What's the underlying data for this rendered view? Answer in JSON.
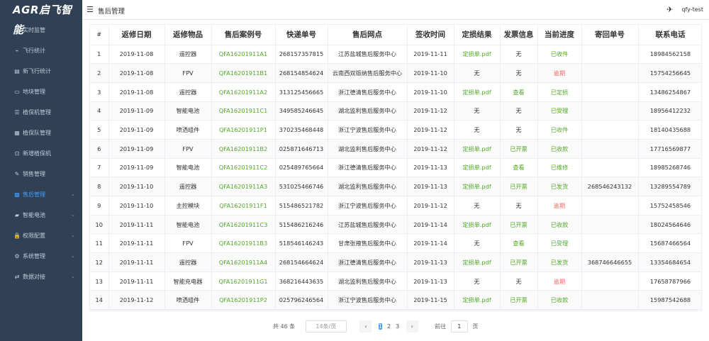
{
  "app": {
    "logo": "AGR启飞智能"
  },
  "sidebar": {
    "items": [
      {
        "icon": "◎",
        "label": "实时监管",
        "chevron": false,
        "active": false
      },
      {
        "icon": "⌁",
        "label": "飞行统计",
        "chevron": false,
        "active": false
      },
      {
        "icon": "▤",
        "label": "新飞行统计",
        "chevron": false,
        "active": false
      },
      {
        "icon": "▭",
        "label": "地块管理",
        "chevron": false,
        "active": false
      },
      {
        "icon": "☰",
        "label": "植保机管理",
        "chevron": false,
        "active": false
      },
      {
        "icon": "▦",
        "label": "植保队管理",
        "chevron": false,
        "active": false
      },
      {
        "icon": "⊡",
        "label": "新增植保机",
        "chevron": false,
        "active": false
      },
      {
        "icon": "✎",
        "label": "销售管理",
        "chevron": false,
        "active": false
      },
      {
        "icon": "▩",
        "label": "售后管理",
        "chevron": true,
        "active": true
      },
      {
        "icon": "▰",
        "label": "智能电池",
        "chevron": true,
        "active": false
      },
      {
        "icon": "🔒",
        "label": "权限配置",
        "chevron": true,
        "active": false
      },
      {
        "icon": "⚙",
        "label": "系统管理",
        "chevron": true,
        "active": false
      },
      {
        "icon": "⇄",
        "label": "数据对接",
        "chevron": true,
        "active": false
      }
    ]
  },
  "header": {
    "title": "售后管理",
    "username": "qfy-test"
  },
  "table": {
    "columns": [
      "#",
      "返修日期",
      "返修物品",
      "售后案例号",
      "快递单号",
      "售后网点",
      "签收时间",
      "定损结果",
      "发票信息",
      "当前进度",
      "寄回单号",
      "联系电话"
    ],
    "rows": [
      [
        "1",
        "2019-11-08",
        "遥控器",
        "QFA16201911A1",
        "268157357815",
        "江苏盐城售后服务中心",
        "2019-11-11",
        "定损单.pdf",
        "无",
        "已收件",
        "",
        "18984562158"
      ],
      [
        "2",
        "2019-11-08",
        "FPV",
        "QFA16201911B1",
        "268154854624",
        "云南西双版纳售后服务中心",
        "2019-11-10",
        "无",
        "无",
        "逾期",
        "",
        "15754256645"
      ],
      [
        "3",
        "2019-11-08",
        "遥控器",
        "QFA16201911A2",
        "313125456665",
        "浙江德清售后服务中心",
        "2019-11-10",
        "定损单.pdf",
        "查看",
        "已定损",
        "",
        "13486254867"
      ],
      [
        "4",
        "2019-11-09",
        "智能电池",
        "QFA16201911C1",
        "349585246645",
        "湖北监利售后服务中心",
        "2019-11-12",
        "无",
        "无",
        "已受理",
        "",
        "18956412232"
      ],
      [
        "5",
        "2019-11-09",
        "喷洒组件",
        "QFA16201911P1",
        "370235468448",
        "浙江宁波售后服务中心",
        "2019-11-12",
        "无",
        "无",
        "已收件",
        "",
        "18140435688"
      ],
      [
        "6",
        "2019-11-09",
        "FPV",
        "QFA16201911B2",
        "025871646713",
        "湖北监利售后服务中心",
        "2019-11-12",
        "定损单.pdf",
        "已开票",
        "已收款",
        "",
        "17716569877"
      ],
      [
        "7",
        "2019-11-09",
        "智能电池",
        "QFA16201911C2",
        "025489765664",
        "浙江德清售后服务中心",
        "2019-11-13",
        "定损单.pdf",
        "查看",
        "已维修",
        "",
        "18985268746"
      ],
      [
        "8",
        "2019-11-10",
        "遥控器",
        "QFA16201911A3",
        "531025466746",
        "湖北监利售后服务中心",
        "2019-11-13",
        "定损单.pdf",
        "已开票",
        "已发货",
        "268546243132",
        "13289554789"
      ],
      [
        "9",
        "2019-11-10",
        "主控模块",
        "QFA16201911F1",
        "515486521782",
        "浙江宁波售后服务中心",
        "2019-11-12",
        "无",
        "无",
        "逾期",
        "",
        "15752458546"
      ],
      [
        "10",
        "2019-11-11",
        "智能电池",
        "QFA16201911C3",
        "515486216246",
        "江苏盐城售后服务中心",
        "2019-11-14",
        "定损单.pdf",
        "已开票",
        "已收款",
        "",
        "18024564646"
      ],
      [
        "11",
        "2019-11-11",
        "FPV",
        "QFA16201911B3",
        "518546146243",
        "甘肃张掖售后服务中心",
        "2019-11-14",
        "无",
        "查看",
        "已受理",
        "",
        "15687466564"
      ],
      [
        "12",
        "2019-11-11",
        "遥控器",
        "QFA16201911A4",
        "268154664624",
        "浙江德清售后服务中心",
        "2019-11-13",
        "定损单.pdf",
        "已开票",
        "已发货",
        "368746646655",
        "13354684654"
      ],
      [
        "13",
        "2019-11-11",
        "智能充电器",
        "QFA16201911G1",
        "368216443635",
        "湖北监利售后服务中心",
        "2019-11-13",
        "无",
        "无",
        "逾期",
        "",
        "17658787966"
      ],
      [
        "14",
        "2019-11-12",
        "喷洒组件",
        "QFA16201911P2",
        "025796246564",
        "浙江宁波售后服务中心",
        "2019-11-15",
        "定损单.pdf",
        "已开票",
        "已收款",
        "",
        "15987542688"
      ]
    ]
  },
  "pagination": {
    "total_text": "共 46 条",
    "page_size": "14条/页",
    "prev": "‹",
    "pages": [
      "1",
      "2",
      "3"
    ],
    "current_page": "1",
    "next": "›",
    "goto_label": "前往",
    "goto_value": "1",
    "goto_suffix": "页"
  },
  "colors": {
    "sidebar_bg": "#304156",
    "accent": "#409eff",
    "green": "#52a928",
    "red": "#f56c6c"
  }
}
